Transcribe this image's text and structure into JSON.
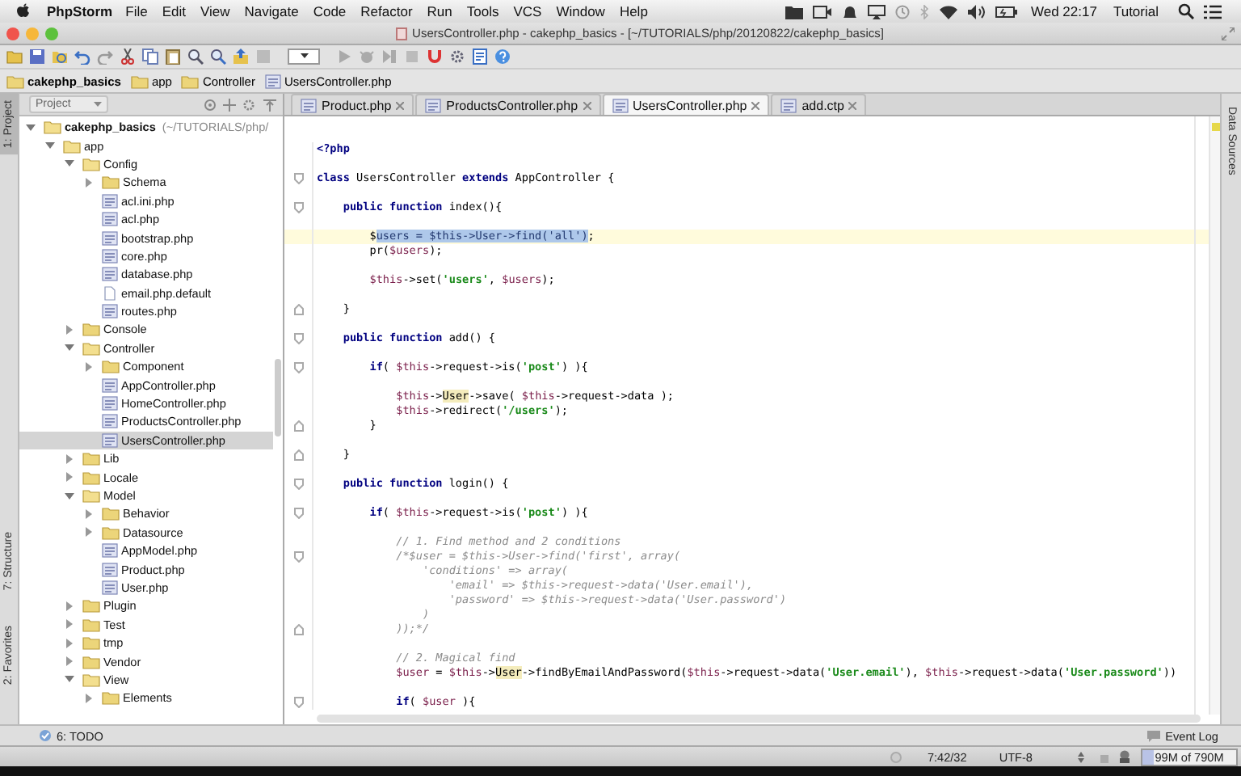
{
  "menu_bar": {
    "app": "PhpStorm",
    "items": [
      "File",
      "Edit",
      "View",
      "Navigate",
      "Code",
      "Refactor",
      "Run",
      "Tools",
      "VCS",
      "Window",
      "Help"
    ],
    "clock": "Wed 22:17",
    "user": "Tutorial"
  },
  "window": {
    "title": "UsersController.php - cakephp_basics - [~/TUTORIALS/php/20120822/cakephp_basics]"
  },
  "breadcrumbs": [
    {
      "label": "cakephp_basics",
      "kind": "folder",
      "bold": true
    },
    {
      "label": "app",
      "kind": "folder",
      "bold": false
    },
    {
      "label": "Controller",
      "kind": "folder",
      "bold": false
    },
    {
      "label": "UsersController.php",
      "kind": "file",
      "bold": false
    }
  ],
  "left_strip": [
    {
      "label": "1: Project",
      "selected": true
    },
    {
      "label": "7: Structure",
      "selected": false
    },
    {
      "label": "2: Favorites",
      "selected": false
    }
  ],
  "right_strip": [
    {
      "label": "Data Sources"
    }
  ],
  "project_panel": {
    "view": "Project",
    "tree": [
      {
        "name": "cakephp_basics",
        "hint": "(~/TUTORIALS/php/",
        "kind": "folder",
        "expanded": true,
        "selected": false,
        "children": [
          {
            "name": "app",
            "kind": "folder",
            "expanded": true,
            "selected": false,
            "children": [
              {
                "name": "Config",
                "kind": "folder",
                "expanded": true,
                "selected": false,
                "children": [
                  {
                    "name": "Schema",
                    "kind": "folder",
                    "expanded": false,
                    "selected": false
                  },
                  {
                    "name": "acl.ini.php",
                    "kind": "php",
                    "selected": false
                  },
                  {
                    "name": "acl.php",
                    "kind": "php",
                    "selected": false
                  },
                  {
                    "name": "bootstrap.php",
                    "kind": "php",
                    "selected": false
                  },
                  {
                    "name": "core.php",
                    "kind": "php",
                    "selected": false
                  },
                  {
                    "name": "database.php",
                    "kind": "php",
                    "selected": false
                  },
                  {
                    "name": "email.php.default",
                    "kind": "text",
                    "selected": false
                  },
                  {
                    "name": "routes.php",
                    "kind": "php",
                    "selected": false
                  }
                ]
              },
              {
                "name": "Console",
                "kind": "folder",
                "expanded": false,
                "selected": false
              },
              {
                "name": "Controller",
                "kind": "folder",
                "expanded": true,
                "selected": false,
                "children": [
                  {
                    "name": "Component",
                    "kind": "folder",
                    "expanded": false,
                    "selected": false
                  },
                  {
                    "name": "AppController.php",
                    "kind": "php",
                    "selected": false
                  },
                  {
                    "name": "HomeController.php",
                    "kind": "php",
                    "selected": false
                  },
                  {
                    "name": "ProductsController.php",
                    "kind": "php",
                    "selected": false
                  },
                  {
                    "name": "UsersController.php",
                    "kind": "php",
                    "selected": true
                  }
                ]
              },
              {
                "name": "Lib",
                "kind": "folder",
                "expanded": false,
                "selected": false
              },
              {
                "name": "Locale",
                "kind": "folder",
                "expanded": false,
                "selected": false
              },
              {
                "name": "Model",
                "kind": "folder",
                "expanded": true,
                "selected": false,
                "children": [
                  {
                    "name": "Behavior",
                    "kind": "folder",
                    "expanded": false,
                    "selected": false
                  },
                  {
                    "name": "Datasource",
                    "kind": "folder",
                    "expanded": false,
                    "selected": false
                  },
                  {
                    "name": "AppModel.php",
                    "kind": "php",
                    "selected": false
                  },
                  {
                    "name": "Product.php",
                    "kind": "php",
                    "selected": false
                  },
                  {
                    "name": "User.php",
                    "kind": "php",
                    "selected": false
                  }
                ]
              },
              {
                "name": "Plugin",
                "kind": "folder",
                "expanded": false,
                "selected": false
              },
              {
                "name": "Test",
                "kind": "folder",
                "expanded": false,
                "selected": false
              },
              {
                "name": "tmp",
                "kind": "folder",
                "expanded": false,
                "selected": false
              },
              {
                "name": "Vendor",
                "kind": "folder",
                "expanded": false,
                "selected": false
              },
              {
                "name": "View",
                "kind": "folder",
                "expanded": true,
                "selected": false,
                "children": [
                  {
                    "name": "Elements",
                    "kind": "folder",
                    "expanded": false,
                    "selected": false
                  }
                ]
              }
            ]
          }
        ]
      }
    ]
  },
  "tabs": [
    {
      "label": "Product.php",
      "selected": false
    },
    {
      "label": "ProductsController.php",
      "selected": false
    },
    {
      "label": "UsersController.php",
      "selected": true
    },
    {
      "label": "add.ctp",
      "selected": false
    }
  ],
  "editor": {
    "lines": [
      {
        "current": false,
        "fold_start": false,
        "fold_end": false,
        "segments": [
          {
            "kind": "kw",
            "text": "<?php"
          }
        ]
      },
      {
        "current": false,
        "fold_start": false,
        "fold_end": false
      },
      {
        "current": false,
        "fold_start": true,
        "fold_end": false,
        "segments": [
          {
            "kind": "kw",
            "text": "class"
          },
          {
            "kind": "plain",
            "text": " UsersController "
          },
          {
            "kind": "kw",
            "text": "extends"
          },
          {
            "kind": "plain",
            "text": " AppController {"
          }
        ]
      },
      {
        "current": false,
        "fold_start": false,
        "fold_end": false
      },
      {
        "current": false,
        "fold_start": true,
        "fold_end": false,
        "segments": [
          {
            "kind": "kw",
            "text": "    public function"
          },
          {
            "kind": "plain",
            "text": " index(){"
          }
        ]
      },
      {
        "current": false,
        "fold_start": false,
        "fold_end": false
      },
      {
        "current": true,
        "fold_start": false,
        "fold_end": false,
        "segments": [
          {
            "kind": "plain",
            "text": "        $"
          },
          {
            "kind": "selected",
            "text": "users = $this->User->find('all')"
          },
          {
            "kind": "plain",
            "text": ";"
          }
        ]
      },
      {
        "current": false,
        "fold_start": false,
        "fold_end": false,
        "segments": [
          {
            "kind": "plain",
            "text": "        pr("
          },
          {
            "kind": "var",
            "text": "$users"
          },
          {
            "kind": "plain",
            "text": ");"
          }
        ]
      },
      {
        "current": false,
        "fold_start": false,
        "fold_end": false
      },
      {
        "current": false,
        "fold_start": false,
        "fold_end": false,
        "segments": [
          {
            "kind": "var",
            "text": "        $this"
          },
          {
            "kind": "plain",
            "text": "->set("
          },
          {
            "kind": "str",
            "text": "'users'"
          },
          {
            "kind": "plain",
            "text": ", "
          },
          {
            "kind": "var",
            "text": "$users"
          },
          {
            "kind": "plain",
            "text": ");"
          }
        ]
      },
      {
        "current": false,
        "fold_start": false,
        "fold_end": false
      },
      {
        "current": false,
        "fold_start": false,
        "fold_end": true,
        "segments": [
          {
            "kind": "plain",
            "text": "    }"
          }
        ]
      },
      {
        "current": false,
        "fold_start": false,
        "fold_end": false
      },
      {
        "current": false,
        "fold_start": true,
        "fold_end": false,
        "segments": [
          {
            "kind": "kw",
            "text": "    public function"
          },
          {
            "kind": "plain",
            "text": " add() {"
          }
        ]
      },
      {
        "current": false,
        "fold_start": false,
        "fold_end": false
      },
      {
        "current": false,
        "fold_start": true,
        "fold_end": false,
        "segments": [
          {
            "kind": "kw",
            "text": "        if"
          },
          {
            "kind": "plain",
            "text": "( "
          },
          {
            "kind": "var",
            "text": "$this"
          },
          {
            "kind": "plain",
            "text": "->request->is("
          },
          {
            "kind": "str",
            "text": "'post'"
          },
          {
            "kind": "plain",
            "text": ") ){"
          }
        ]
      },
      {
        "current": false,
        "fold_start": false,
        "fold_end": false
      },
      {
        "current": false,
        "fold_start": false,
        "fold_end": false,
        "segments": [
          {
            "kind": "var",
            "text": "            $this"
          },
          {
            "kind": "plain",
            "text": "->"
          },
          {
            "kind": "match",
            "text": "User"
          },
          {
            "kind": "plain",
            "text": "->save( "
          },
          {
            "kind": "var",
            "text": "$this"
          },
          {
            "kind": "plain",
            "text": "->request->data );"
          }
        ]
      },
      {
        "current": false,
        "fold_start": false,
        "fold_end": false,
        "segments": [
          {
            "kind": "var",
            "text": "            $this"
          },
          {
            "kind": "plain",
            "text": "->redirect("
          },
          {
            "kind": "str",
            "text": "'/users'"
          },
          {
            "kind": "plain",
            "text": ");"
          }
        ]
      },
      {
        "current": false,
        "fold_start": false,
        "fold_end": true,
        "segments": [
          {
            "kind": "plain",
            "text": "        }"
          }
        ]
      },
      {
        "current": false,
        "fold_start": false,
        "fold_end": false
      },
      {
        "current": false,
        "fold_start": false,
        "fold_end": true,
        "segments": [
          {
            "kind": "plain",
            "text": "    }"
          }
        ]
      },
      {
        "current": false,
        "fold_start": false,
        "fold_end": false
      },
      {
        "current": false,
        "fold_start": true,
        "fold_end": false,
        "segments": [
          {
            "kind": "kw",
            "text": "    public function"
          },
          {
            "kind": "plain",
            "text": " login() {"
          }
        ]
      },
      {
        "current": false,
        "fold_start": false,
        "fold_end": false
      },
      {
        "current": false,
        "fold_start": true,
        "fold_end": false,
        "segments": [
          {
            "kind": "kw",
            "text": "        if"
          },
          {
            "kind": "plain",
            "text": "( "
          },
          {
            "kind": "var",
            "text": "$this"
          },
          {
            "kind": "plain",
            "text": "->request->is("
          },
          {
            "kind": "str",
            "text": "'post'"
          },
          {
            "kind": "plain",
            "text": ") ){"
          }
        ]
      },
      {
        "current": false,
        "fold_start": false,
        "fold_end": false
      },
      {
        "current": false,
        "fold_start": false,
        "fold_end": false,
        "segments": [
          {
            "kind": "comment",
            "text": "            // 1. Find method and 2 conditions"
          }
        ]
      },
      {
        "current": false,
        "fold_start": true,
        "fold_end": false,
        "segments": [
          {
            "kind": "comment",
            "text": "            /*$user = $this->User->find('first', array("
          }
        ]
      },
      {
        "current": false,
        "fold_start": false,
        "fold_end": false,
        "segments": [
          {
            "kind": "comment",
            "text": "                'conditions' => array("
          }
        ]
      },
      {
        "current": false,
        "fold_start": false,
        "fold_end": false,
        "segments": [
          {
            "kind": "comment",
            "text": "                    'email' => $this->request->data('User.email'),"
          }
        ]
      },
      {
        "current": false,
        "fold_start": false,
        "fold_end": false,
        "segments": [
          {
            "kind": "comment",
            "text": "                    'password' => $this->request->data('User.password')"
          }
        ]
      },
      {
        "current": false,
        "fold_start": false,
        "fold_end": false,
        "segments": [
          {
            "kind": "comment",
            "text": "                )"
          }
        ]
      },
      {
        "current": false,
        "fold_start": false,
        "fold_end": true,
        "segments": [
          {
            "kind": "comment",
            "text": "            ));*/"
          }
        ]
      },
      {
        "current": false,
        "fold_start": false,
        "fold_end": false
      },
      {
        "current": false,
        "fold_start": false,
        "fold_end": false,
        "segments": [
          {
            "kind": "comment",
            "text": "            // 2. Magical find"
          }
        ]
      },
      {
        "current": false,
        "fold_start": false,
        "fold_end": false,
        "segments": [
          {
            "kind": "var",
            "text": "            $user"
          },
          {
            "kind": "plain",
            "text": " = "
          },
          {
            "kind": "var",
            "text": "$this"
          },
          {
            "kind": "plain",
            "text": "->"
          },
          {
            "kind": "match",
            "text": "User"
          },
          {
            "kind": "plain",
            "text": "->findByEmailAndPassword("
          },
          {
            "kind": "var",
            "text": "$this"
          },
          {
            "kind": "plain",
            "text": "->request->data("
          },
          {
            "kind": "str",
            "text": "'User.email'"
          },
          {
            "kind": "plain",
            "text": "), "
          },
          {
            "kind": "var",
            "text": "$this"
          },
          {
            "kind": "plain",
            "text": "->request->data("
          },
          {
            "kind": "str",
            "text": "'User.password'"
          },
          {
            "kind": "plain",
            "text": "))"
          }
        ]
      },
      {
        "current": false,
        "fold_start": false,
        "fold_end": false
      },
      {
        "current": false,
        "fold_start": true,
        "fold_end": false,
        "segments": [
          {
            "kind": "kw",
            "text": "            if"
          },
          {
            "kind": "plain",
            "text": "( "
          },
          {
            "kind": "var",
            "text": "$user"
          },
          {
            "kind": "plain",
            "text": " ){"
          }
        ]
      }
    ]
  },
  "bottom_bar": {
    "todo": "6: TODO",
    "event_log": "Event Log"
  },
  "status_bar": {
    "position": "7:42/32",
    "encoding": "UTF-8",
    "memory": {
      "text": "99M of 790M",
      "level": 0.125
    }
  }
}
